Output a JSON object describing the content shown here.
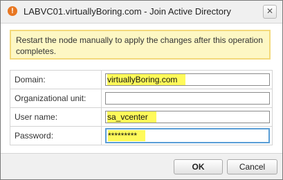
{
  "dialog": {
    "title": "LABVC01.virtuallyBoring.com - Join Active Directory",
    "warning_icon": "warning-icon",
    "close_icon": "close-icon"
  },
  "warning": {
    "message": "Restart the node manually to apply the changes after this operation completes."
  },
  "form": {
    "domain_label": "Domain:",
    "domain_value": "virtuallyBoring.com",
    "ou_label": "Organizational unit:",
    "ou_value": "",
    "username_label": "User name:",
    "username_value": "sa_vcenter",
    "password_label": "Password:",
    "password_value": "*********"
  },
  "buttons": {
    "ok_label": "OK",
    "cancel_label": "Cancel"
  },
  "colors": {
    "warning_bg": "#fdf7c4",
    "warning_border": "#f3d97a",
    "highlight": "#fffa5a",
    "focus_border": "#5a9ed6",
    "icon_orange": "#e87722"
  }
}
